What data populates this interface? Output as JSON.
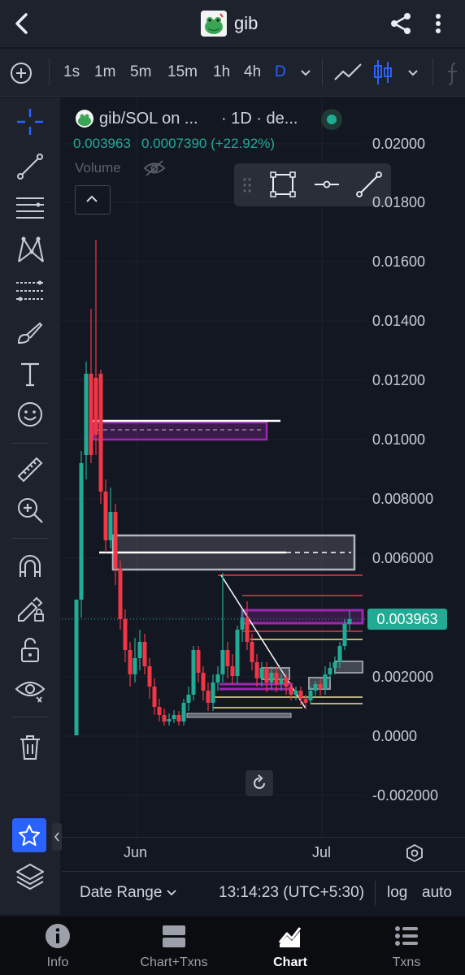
{
  "header": {
    "title": "gib"
  },
  "timeframes": [
    "1s",
    "1m",
    "5m",
    "15m",
    "1h",
    "4h",
    "D"
  ],
  "legend": {
    "symbol": "gib/SOL on ...",
    "meta": "· 1D · de...",
    "price": "0.003963",
    "change": "0.0007390 (+22.92%)",
    "volume": "Volume"
  },
  "price_axis": [
    "0.02000",
    "0.01800",
    "0.01600",
    "0.01400",
    "0.01200",
    "0.01000",
    "0.008000",
    "0.006000",
    "0.002000",
    "0.0000",
    "-0.002000"
  ],
  "last_price": "0.003963",
  "time_axis": [
    "Jun",
    "Jul"
  ],
  "footer": {
    "date_range": "Date Range",
    "clock": "13:14:23 (UTC+5:30)",
    "log": "log",
    "auto": "auto"
  },
  "tabs": [
    {
      "label": "Info",
      "icon": "info-icon"
    },
    {
      "label": "Chart+Txns",
      "icon": "chart-txns-icon"
    },
    {
      "label": "Chart",
      "icon": "chart-icon",
      "active": true
    },
    {
      "label": "Txns",
      "icon": "txns-icon"
    }
  ],
  "colors": {
    "up": "#22ab94",
    "down": "#f23645",
    "accent": "#2962ff",
    "background": "#131722",
    "panel": "#1e222d"
  }
}
